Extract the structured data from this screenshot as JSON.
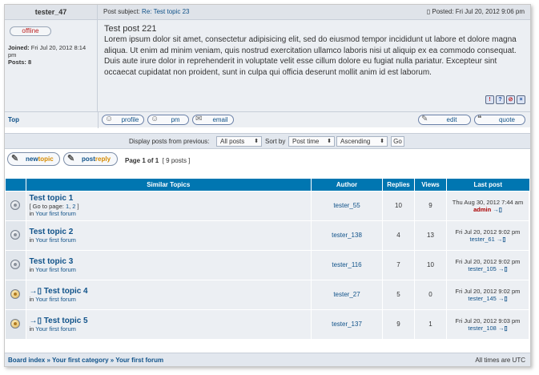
{
  "post": {
    "author": "tester_47",
    "subject_label": "Post subject:",
    "subject_link": "Re: Test topic 23",
    "posted": "Posted: Fri Jul 20, 2012 9:06 pm",
    "status": "offline",
    "joined_label": "Joined:",
    "joined_value": "Fri Jul 20, 2012 8:14 pm",
    "posts_label": "Posts:",
    "posts_value": "8",
    "title": "Test post 221",
    "body": "Lorem ipsum dolor sit amet, consectetur adipisicing elit, sed do eiusmod tempor incididunt ut labore et dolore magna aliqua. Ut enim ad minim veniam, quis nostrud exercitation ullamco laboris nisi ut aliquip ex ea commodo consequat. Duis aute irure dolor in reprehenderit in voluptate velit esse cillum dolore eu fugiat nulla pariatur. Excepteur sint occaecat cupidatat non proident, sunt in culpa qui officia deserunt mollit anim id est laborum.",
    "top_link": "Top",
    "buttons": {
      "profile": "profile",
      "pm": "pm",
      "email": "email",
      "edit": "edit",
      "quote": "quote"
    }
  },
  "display": {
    "label": "Display posts from previous:",
    "posts_select": "All posts",
    "sort_label": "Sort by",
    "sort_select": "Post time",
    "order_select": "Ascending",
    "go": "Go"
  },
  "actions": {
    "newtopic_a": "new",
    "newtopic_b": "topic",
    "postreply_a": "post",
    "postreply_b": "reply",
    "page_info_bold": "Page 1 of 1",
    "page_info_rest": "[ 9 posts ]"
  },
  "similar": {
    "headers": {
      "topics": "Similar Topics",
      "author": "Author",
      "replies": "Replies",
      "views": "Views",
      "last": "Last post"
    },
    "rows": [
      {
        "title": "Test topic 1",
        "goto_prefix": "[ Go to page: ",
        "goto_p1": "1",
        "goto_sep": ", ",
        "goto_p2": "2",
        "goto_suffix": " ]",
        "in_prefix": "in ",
        "forum": "Your first forum",
        "author": "tester_55",
        "replies": "10",
        "views": "9",
        "last_date": "Thu Aug 30, 2012 7:44 am",
        "last_user": "admin",
        "new": false
      },
      {
        "title": "Test topic 2",
        "in_prefix": "in ",
        "forum": "Your first forum",
        "author": "tester_138",
        "replies": "4",
        "views": "13",
        "last_date": "Fri Jul 20, 2012 9:02 pm",
        "last_user": "tester_61",
        "new": false
      },
      {
        "title": "Test topic 3",
        "in_prefix": "in ",
        "forum": "Your first forum",
        "author": "tester_116",
        "replies": "7",
        "views": "10",
        "last_date": "Fri Jul 20, 2012 9:02 pm",
        "last_user": "tester_105",
        "new": false
      },
      {
        "title": "Test topic 4",
        "in_prefix": "in ",
        "forum": "Your first forum",
        "author": "tester_27",
        "replies": "5",
        "views": "0",
        "last_date": "Fri Jul 20, 2012 9:02 pm",
        "last_user": "tester_145",
        "new": true
      },
      {
        "title": "Test topic 5",
        "in_prefix": "in ",
        "forum": "Your first forum",
        "author": "tester_137",
        "replies": "9",
        "views": "1",
        "last_date": "Fri Jul 20, 2012 9:03 pm",
        "last_user": "tester_108",
        "new": true
      }
    ]
  },
  "footer": {
    "crumb1": "Board index",
    "sep": " » ",
    "crumb2": "Your first category",
    "crumb3": "Your first forum",
    "timezone": "All times are UTC"
  },
  "icons": {
    "last_post_marker": "→▯",
    "new_marker": "→▯"
  }
}
